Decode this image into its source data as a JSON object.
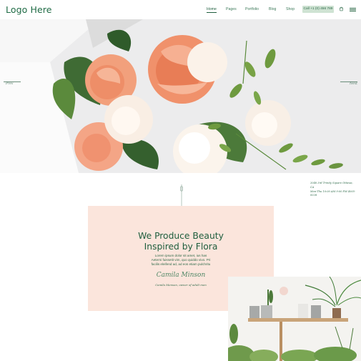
{
  "header": {
    "logo": "Logo Here",
    "nav": [
      "Home",
      "Pages",
      "Portfolio",
      "Blog",
      "Shop"
    ],
    "phone": "Call +1 (0) 456 789"
  },
  "hero": {
    "prev_label": "Prev",
    "next_label": "Next"
  },
  "address": {
    "line1": "2046 3rd Trinity Square Ottawa, CA",
    "line2": "Mon-Thu 10:00 AM 9:00 PM 4005-0028"
  },
  "card": {
    "title_line1": "We Produce Beauty",
    "title_line2": "Inspired by Flora",
    "text_line1": "Lorem ipsum dolor sit amet, ius has",
    "text_line2": "Aeterni fuissetit vim, quo quiddo vivo. Pri",
    "text_line3": "facilis eleifend ad, ad eos etiam pulchritu",
    "signature": "Camila Minson",
    "signer": "Camila Menson, owner of adult men"
  },
  "colors": {
    "brand_green": "#1f6b45",
    "card_bg": "#fbe5dc",
    "phone_bg": "#cfe3d3"
  }
}
